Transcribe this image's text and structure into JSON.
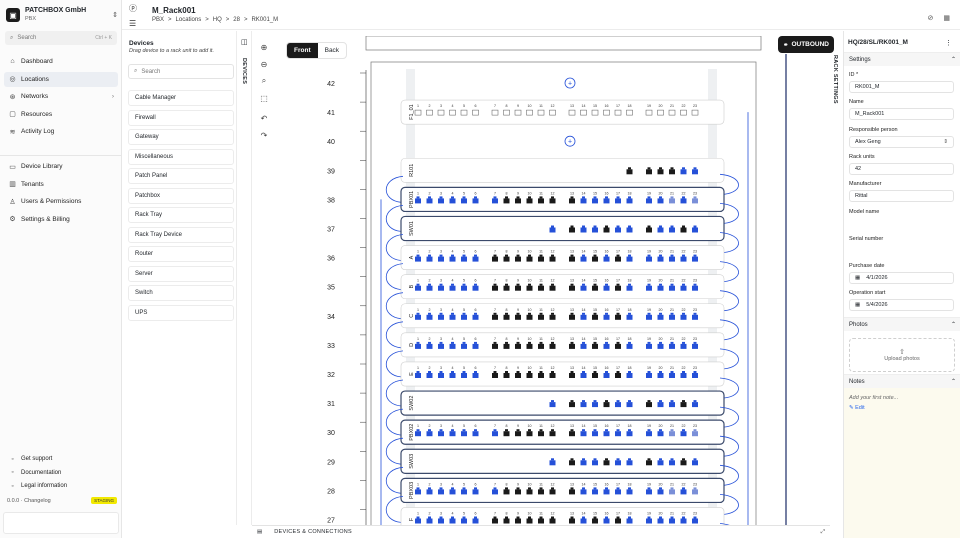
{
  "org": {
    "name": "PATCHBOX GmbH",
    "sub": "PBX"
  },
  "search": {
    "placeholder": "Search",
    "shortcut": "Ctrl + K"
  },
  "nav": {
    "items": [
      {
        "label": "Dashboard",
        "icon": "home-icon"
      },
      {
        "label": "Locations",
        "icon": "pin-icon",
        "active": true
      },
      {
        "label": "Networks",
        "icon": "network-icon",
        "chevron": true
      },
      {
        "label": "Resources",
        "icon": "box-icon"
      },
      {
        "label": "Activity Log",
        "icon": "activity-icon"
      }
    ],
    "items2": [
      {
        "label": "Device Library",
        "icon": "library-icon"
      },
      {
        "label": "Tenants",
        "icon": "building-icon"
      },
      {
        "label": "Users & Permissions",
        "icon": "users-icon"
      },
      {
        "label": "Settings & Billing",
        "icon": "gear-icon"
      }
    ],
    "footer": [
      {
        "label": "Get support"
      },
      {
        "label": "Documentation"
      },
      {
        "label": "Legal information"
      }
    ],
    "version": "0.0.0 · Changelog",
    "env": "STAGING"
  },
  "header": {
    "title": "M_Rack001",
    "crumbs": [
      "PBX",
      ">",
      "Locations",
      ">",
      "HQ",
      ">",
      "28",
      ">",
      "RK001_M"
    ]
  },
  "devices": {
    "title": "Devices",
    "subtitle": "Drag device to a rack unit to add it.",
    "search_placeholder": "Search",
    "tab_label": "DEVICES",
    "items": [
      "Cable Manager",
      "Firewall",
      "Gateway",
      "Miscellaneous",
      "Patch Panel",
      "Patchbox",
      "Rack Tray",
      "Rack Tray Device",
      "Router",
      "Server",
      "Switch",
      "UPS"
    ]
  },
  "view": {
    "front": "Front",
    "back": "Back"
  },
  "rack": {
    "units": [
      42,
      41,
      40,
      39,
      38,
      37,
      36,
      35,
      34,
      33,
      32,
      31,
      30,
      29,
      28,
      27
    ],
    "devices": [
      {
        "unit": 41,
        "label": "F1_01",
        "kind": "panel"
      },
      {
        "unit": 39,
        "label": "R101",
        "kind": "small"
      },
      {
        "unit": 38,
        "label": "PBX01",
        "kind": "pbx"
      },
      {
        "unit": 37,
        "label": "SW01",
        "kind": "switch"
      },
      {
        "unit": 36,
        "label": "A",
        "kind": "patch"
      },
      {
        "unit": 35,
        "label": "B",
        "kind": "patch"
      },
      {
        "unit": 34,
        "label": "C",
        "kind": "patch"
      },
      {
        "unit": 33,
        "label": "D",
        "kind": "patch"
      },
      {
        "unit": 32,
        "label": "E",
        "kind": "patch"
      },
      {
        "unit": 31,
        "label": "SW02",
        "kind": "switch"
      },
      {
        "unit": 30,
        "label": "PBX02",
        "kind": "pbx"
      },
      {
        "unit": 29,
        "label": "SW03",
        "kind": "switch"
      },
      {
        "unit": 28,
        "label": "PBX03",
        "kind": "pbx"
      },
      {
        "unit": 27,
        "label": "F",
        "kind": "patch"
      }
    ],
    "empty_units": [
      42,
      40
    ]
  },
  "outbound": {
    "label": "OUTBOUND"
  },
  "settings": {
    "path": "HQ/28/SL/RK001_M",
    "tab_label": "RACK SETTINGS",
    "section": "Settings",
    "fields": [
      {
        "label": "ID *",
        "value": "RK001_M"
      },
      {
        "label": "Name",
        "value": "M_Rack001"
      },
      {
        "label": "Responsible person",
        "value": "Alex Geng",
        "select": true
      },
      {
        "label": "Rack units",
        "value": "42"
      },
      {
        "label": "Manufacturer",
        "value": "Rittal"
      },
      {
        "label": "Model name",
        "value": ""
      },
      {
        "label": "Serial number",
        "value": ""
      },
      {
        "label": "Purchase date",
        "value": "4/1/2026",
        "date": true
      },
      {
        "label": "Operation start",
        "value": "5/4/2026",
        "date": true
      }
    ],
    "photos": "Photos",
    "upload": "Upload photos",
    "notes": "Notes",
    "notes_placeholder": "Add your first note...",
    "edit": "Edit"
  },
  "bottombar": {
    "label": "DEVICES & CONNECTIONS"
  },
  "colors": {
    "accent": "#2550d8",
    "dark": "#1a1a1a",
    "staging": "#f2e900"
  }
}
